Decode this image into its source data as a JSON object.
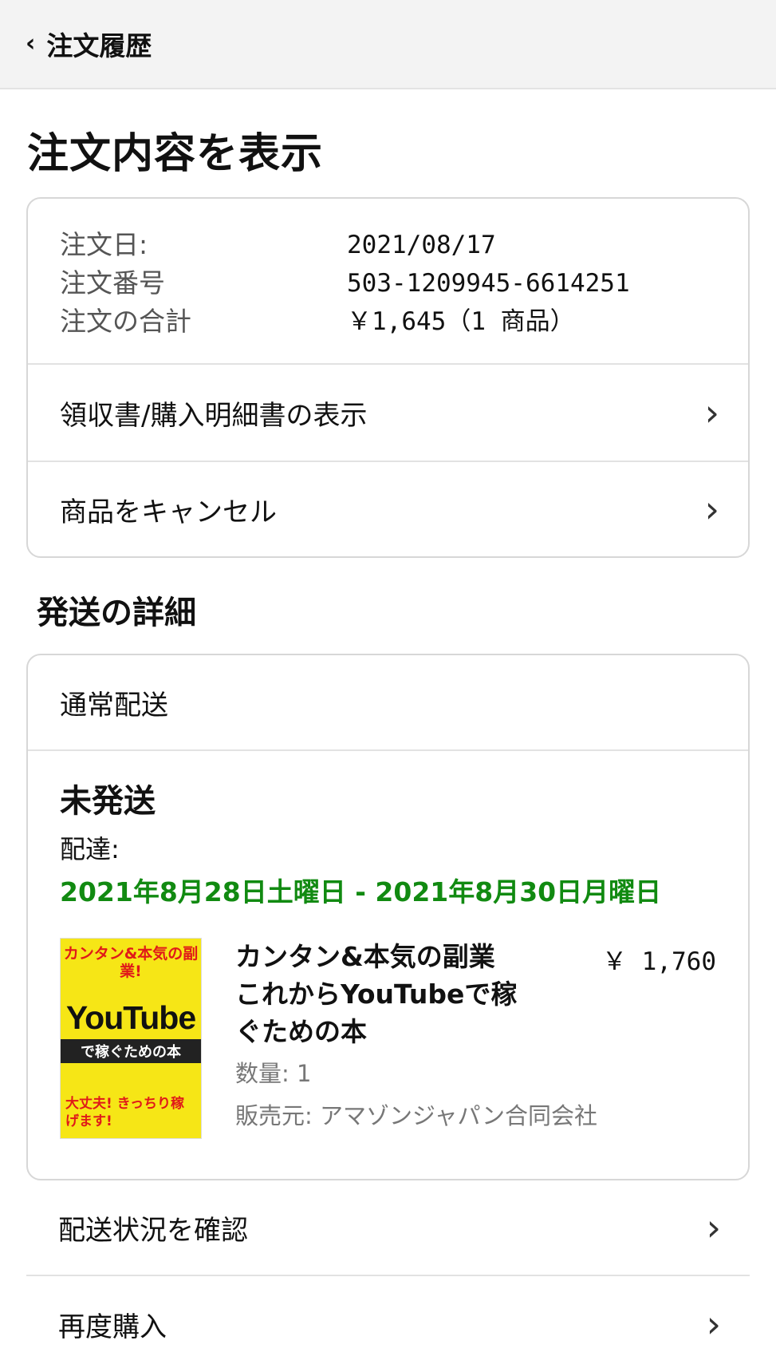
{
  "header": {
    "back_label": "注文履歴"
  },
  "page_title": "注文内容を表示",
  "order_summary": {
    "rows": [
      {
        "label": "注文日:",
        "value": "2021/08/17"
      },
      {
        "label": "注文番号",
        "value": "503-1209945-6614251"
      },
      {
        "label": "注文の合計",
        "value": "￥1,645（1 商品）"
      }
    ]
  },
  "order_links": [
    {
      "label": "領収書/購入明細書の表示"
    },
    {
      "label": "商品をキャンセル"
    }
  ],
  "shipping": {
    "section_title": "発送の詳細",
    "method": "通常配送",
    "status": "未発送",
    "delivery_label": "配達:",
    "delivery_range": "2021年8月28日土曜日 - 2021年8月30日月曜日"
  },
  "item": {
    "title": "カンタン&本気の副業 これからYouTubeで稼ぐための本",
    "price": "￥ 1,760",
    "quantity": "数量: 1",
    "seller": "販売元: アマゾンジャパン合同会社",
    "cover_text": {
      "top": "カンタン&本気の副業!",
      "main": "YouTube",
      "sub": "で稼ぐための本",
      "bottom": "大丈夫! きっちり稼げます!"
    }
  },
  "bottom_links": [
    {
      "label": "配送状況を確認"
    },
    {
      "label": "再度購入"
    }
  ],
  "icons": {
    "back": "chevron-left-icon",
    "row_arrow": "chevron-right-icon"
  },
  "colors": {
    "delivery_green": "#118a11",
    "cover_yellow": "#f6e616",
    "cover_red": "#e01919"
  }
}
